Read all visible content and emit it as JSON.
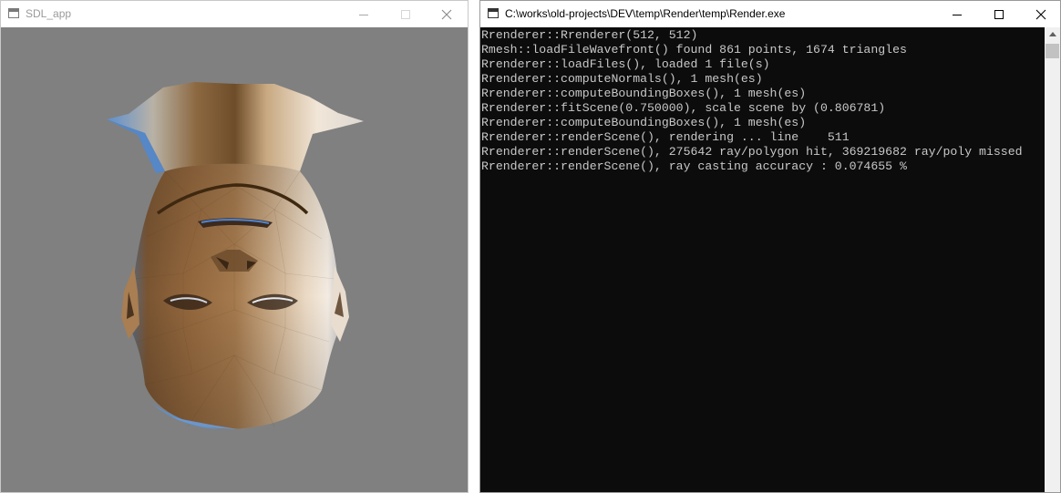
{
  "sdl_window": {
    "title": "SDL_app",
    "viewport_background": "#808080",
    "render_description": "flat-shaded ray-cast 3D head mesh shown upside down"
  },
  "console_window": {
    "title": "C:\\works\\old-projects\\DEV\\temp\\Render\\temp\\Render.exe",
    "background": "#0c0c0c",
    "text_color": "#c8c8c8",
    "lines": [
      "Rrenderer::Rrenderer(512, 512)",
      "Rmesh::loadFileWavefront() found 861 points, 1674 triangles",
      "Rrenderer::loadFiles(), loaded 1 file(s)",
      "Rrenderer::computeNormals(), 1 mesh(es)",
      "Rrenderer::computeBoundingBoxes(), 1 mesh(es)",
      "Rrenderer::fitScene(0.750000), scale scene by (0.806781)",
      "Rrenderer::computeBoundingBoxes(), 1 mesh(es)",
      "Rrenderer::renderScene(), rendering ... line    511",
      "Rrenderer::renderScene(), 275642 ray/polygon hit, 369219682 ray/poly missed",
      "Rrenderer::renderScene(), ray casting accuracy : 0.074655 %"
    ]
  },
  "icons": {
    "app": "window-app-icon",
    "minimize": "minimize-icon",
    "maximize": "maximize-icon",
    "close": "close-icon"
  }
}
